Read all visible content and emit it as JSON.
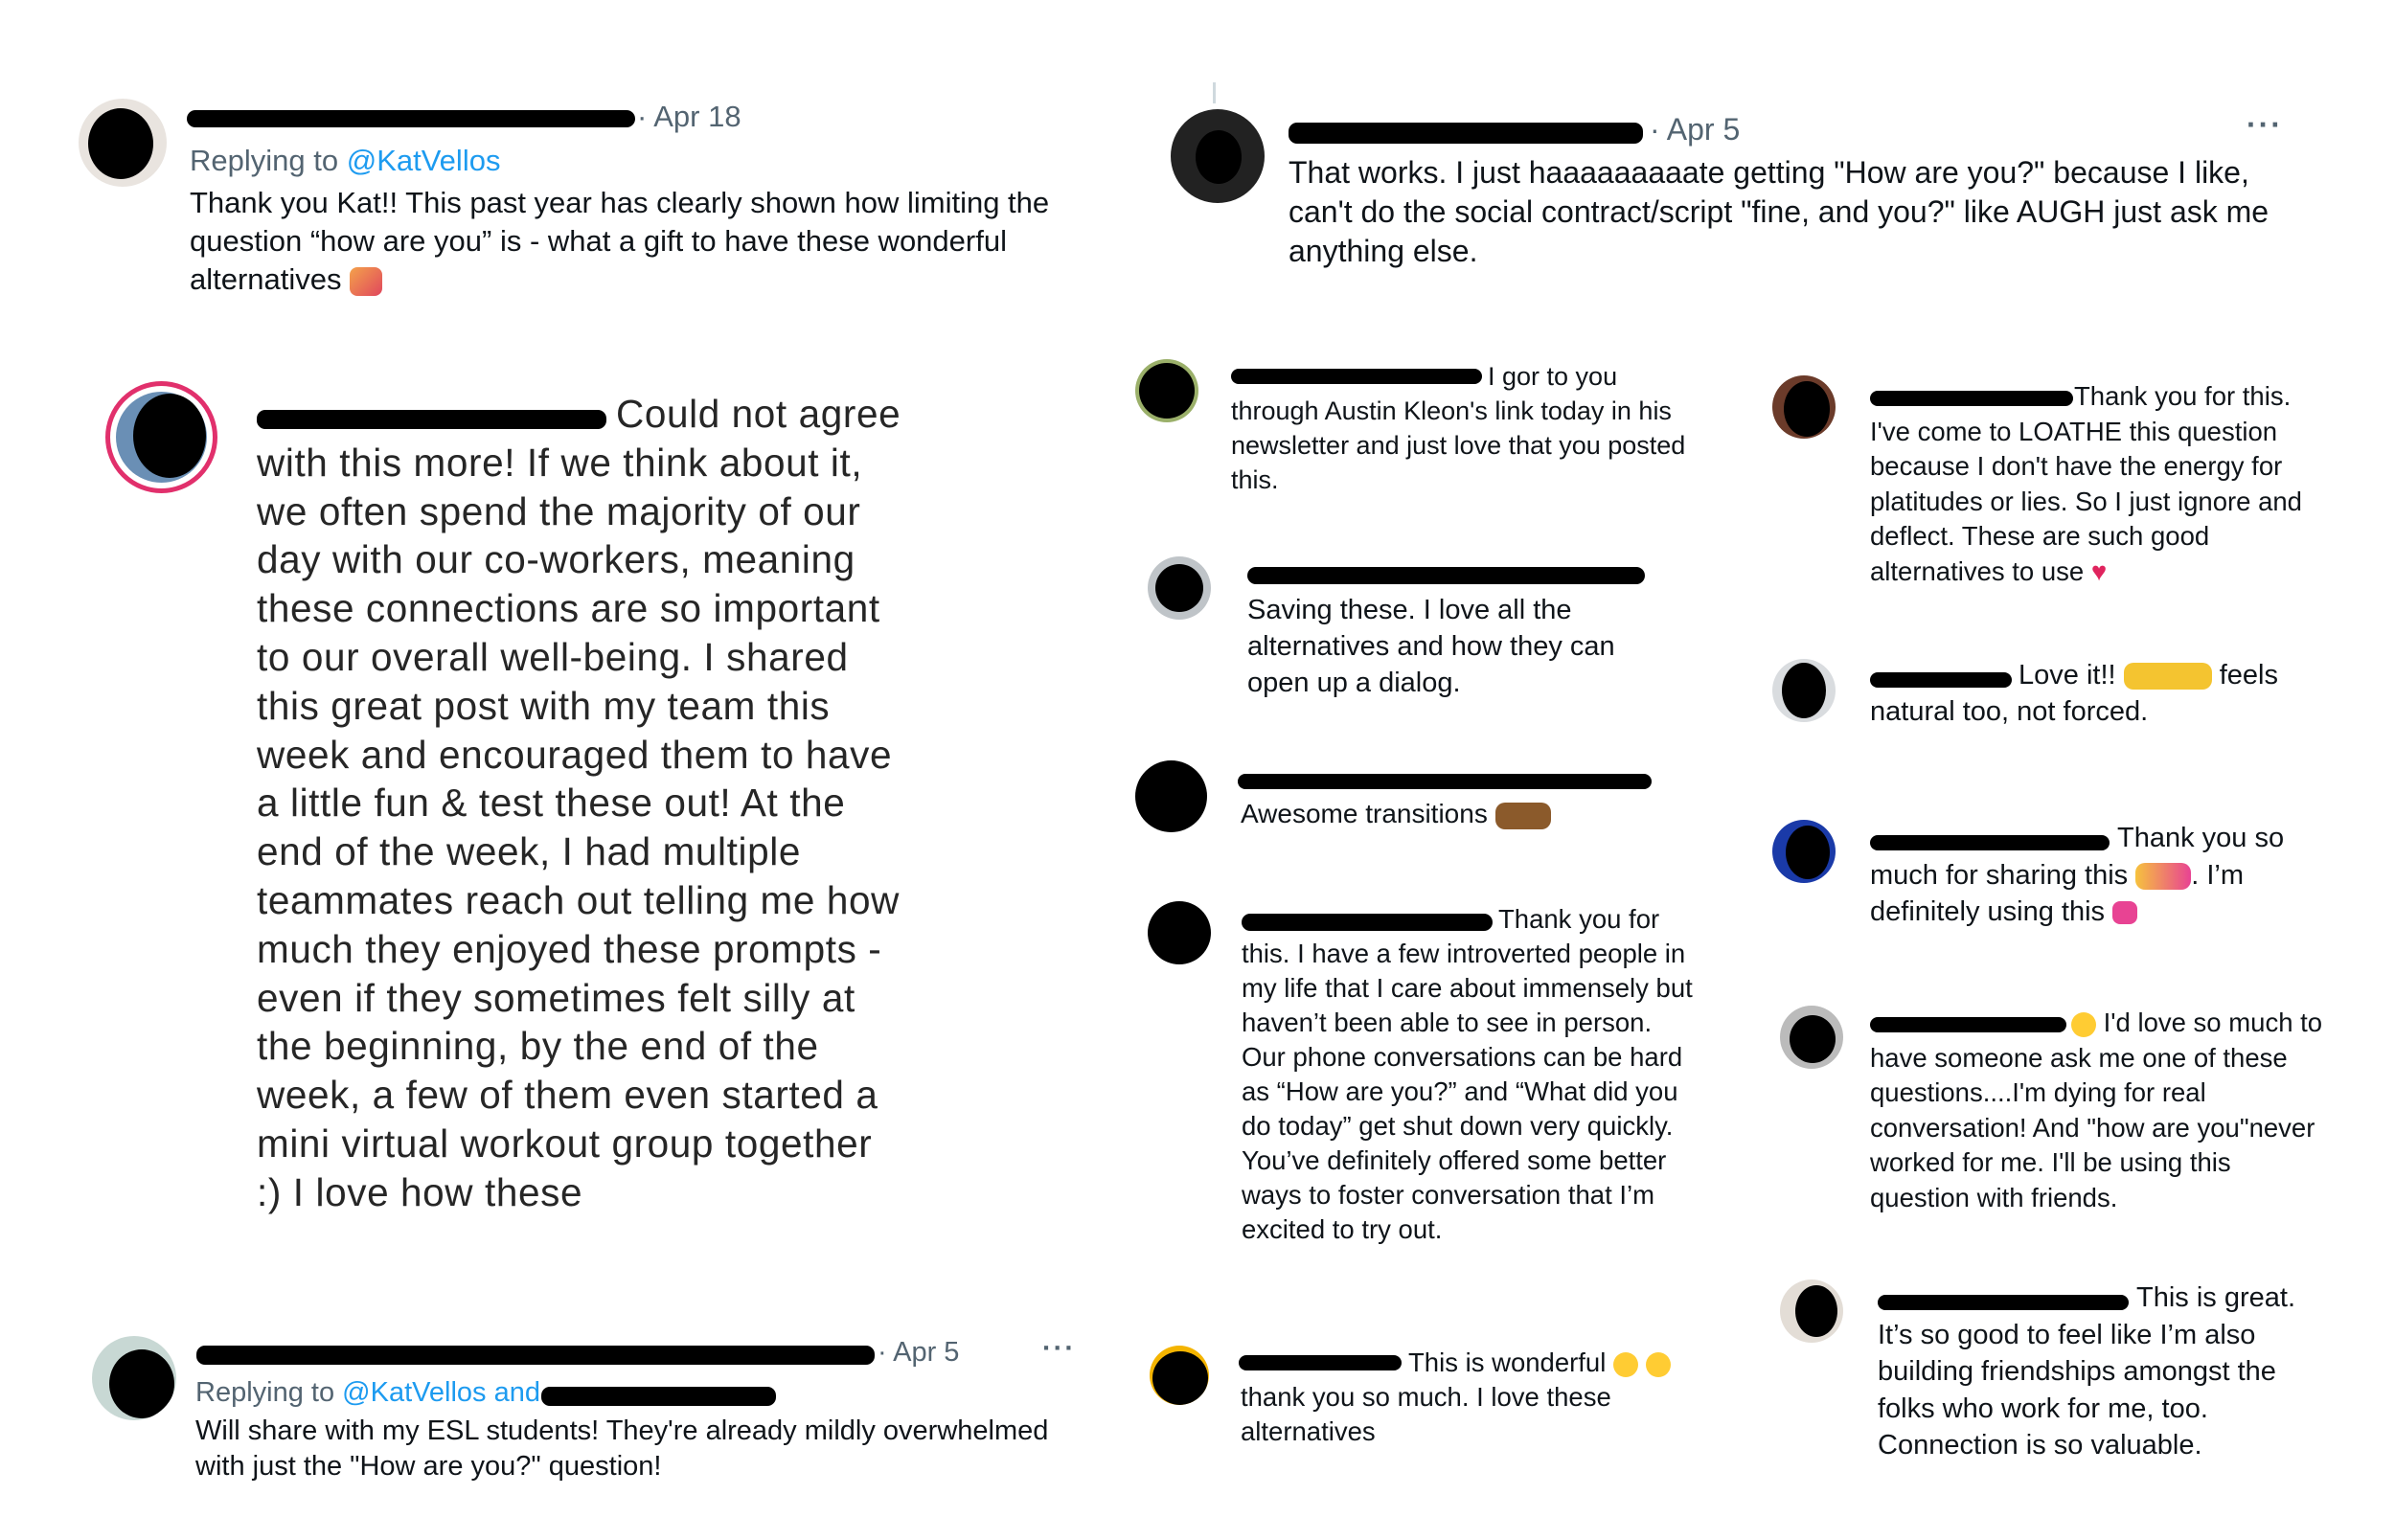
{
  "tweet1": {
    "date": "· Apr 18",
    "replying_prefix": "Replying to ",
    "replying_to": "@KatVellos",
    "text": "Thank you Kat!! This past year has clearly shown how limiting the question “how are you” is - what a gift to have these wonderful alternatives",
    "emoji": "heart-gift-emoji"
  },
  "tweet2": {
    "date": "· Apr 5",
    "text": "That works. I just haaaaaaaaate getting \"How are you?\" because I like, can't do the social contract/script \"fine, and you?\" like AUGH just ask me anything else.",
    "more": "···"
  },
  "ig_large": {
    "text": "Could not agree with this more! If we think about it, we often spend the majority of our day with our co-workers, meaning these connections are so important to our overall well-being. I shared this great post with my team this week and encouraged them to have a little fun & test these out! At the end of the week, I had multiple teammates reach out telling me how much they enjoyed these prompts - even if they sometimes felt silly at the beginning, by the end of the week, a few of them even started a mini virtual workout group together :) I love how these"
  },
  "tweet3": {
    "date": "· Apr 5",
    "replying_prefix": "Replying to ",
    "replying_to": "@KatVellos and",
    "text": "Will share with my ESL students! They're already mildly overwhelmed with just the \"How are you?\" question!",
    "more": "···"
  },
  "comments_mid": [
    {
      "text": "I gor to you through Austin Kleon's link today in his newsletter and just love that you posted this."
    },
    {
      "text": "Saving these. I love all the alternatives and how they can open up a dialog."
    },
    {
      "text": "Awesome transitions",
      "emoji": "clapping-hands-emoji"
    },
    {
      "text": "Thank you for this. I have a few introverted people in my life that I care about immensely but haven’t been able to see in person. Our phone conversations can be hard as “How are you?” and “What did you do today” get shut down very quickly. You’ve definitely offered some better ways to foster conversation that I’m excited to try out."
    },
    {
      "text_a": "This is wonderful",
      "text_b": "thank you so much. I love these alternatives",
      "emoji": "heart-eyes-emoji"
    }
  ],
  "comments_right": [
    {
      "text": "Thank you for this. I've come to LOATHE this question because I don't have the energy for platitudes or lies. So I just ignore and deflect. These are such good alternatives to use",
      "emoji": "red-heart-emoji"
    },
    {
      "text_a": "Love it!!",
      "text_b": "feels natural too, not forced.",
      "emoji": "raised-hands-emoji"
    },
    {
      "text_a": "Thank you so much for sharing this",
      "text_b": ". I’m definitely using this",
      "emoji": "smiling-hearts-emoji"
    },
    {
      "text": "I'd love so much to have someone ask me one of these questions....I'm dying for real conversation! And \"how are you\"never worked for me. I'll be using this question with friends.",
      "emoji": "heart-eyes-emoji"
    },
    {
      "text": "This is great. It’s so good to feel like I’m also building friendships amongst the folks who work for me, too. Connection is so valuable."
    }
  ],
  "colors": {
    "link": "#1d9bf0",
    "meta": "#536471",
    "text": "#0f1419"
  }
}
